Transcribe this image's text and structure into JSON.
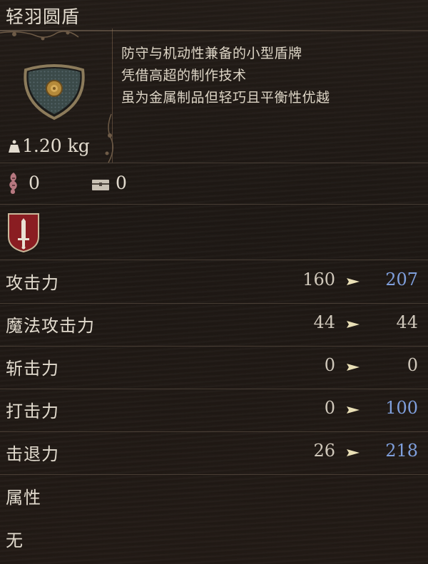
{
  "item": {
    "name": "轻羽圆盾",
    "description": [
      "防守与机动性兼备的小型盾牌",
      "凭借高超的制作技术",
      "虽为金属制品但轻巧且平衡性优越"
    ],
    "weight": "1.20 kg",
    "icon": "round-shield-icon"
  },
  "counters": {
    "left_icon": "bone-charm-icon",
    "left_value": "0",
    "right_icon": "chest-icon",
    "right_value": "0"
  },
  "class_emblem": "sword-emblem-icon",
  "stats": [
    {
      "label": "攻击力",
      "old": "160",
      "new": "207",
      "change": "up"
    },
    {
      "label": "魔法攻击力",
      "old": "44",
      "new": "44",
      "change": "same"
    },
    {
      "label": "斩击力",
      "old": "0",
      "new": "0",
      "change": "same"
    },
    {
      "label": "打击力",
      "old": "0",
      "new": "100",
      "change": "up"
    },
    {
      "label": "击退力",
      "old": "26",
      "new": "218",
      "change": "up"
    }
  ],
  "attribute": {
    "label": "属性",
    "value": "无"
  },
  "colors": {
    "up": "#7f9fdc",
    "text": "#e2dbce",
    "arrow": "#e9dfb6",
    "emblem": "#8a1d22"
  }
}
